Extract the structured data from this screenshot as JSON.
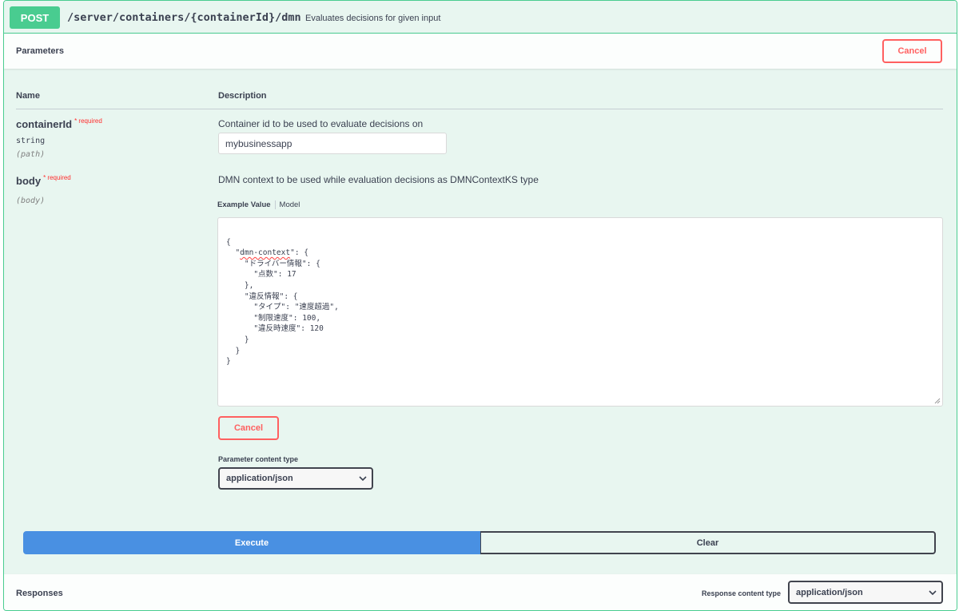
{
  "summary": {
    "method": "POST",
    "path": "/server/containers/{containerId}/dmn",
    "description": "Evaluates decisions for given input"
  },
  "parameters": {
    "title": "Parameters",
    "cancel_label": "Cancel",
    "col_name": "Name",
    "col_description": "Description",
    "required_label": "required",
    "container_id": {
      "name": "containerId",
      "type": "string",
      "in": "(path)",
      "description": "Container id to be used to evaluate decisions on",
      "value": "mybusinessapp"
    },
    "body": {
      "name": "body",
      "in": "(body)",
      "description": "DMN context to be used while evaluation decisions as DMNContextKS type",
      "tab_example": "Example Value",
      "tab_model": "Model",
      "json_lines": [
        "{",
        "  \"dmn-context\": {",
        "    \"ドライバー情報\": {",
        "      \"点数\": 17",
        "    },",
        "    \"違反情報\": {",
        "      \"タイプ\": \"速度超過\",",
        "      \"制限速度\": 100,",
        "      \"違反時速度\": 120",
        "    }",
        "  }",
        "}"
      ],
      "cancel_label": "Cancel",
      "content_type_label": "Parameter content type",
      "content_type_value": "application/json"
    }
  },
  "actions": {
    "execute_label": "Execute",
    "clear_label": "Clear"
  },
  "responses": {
    "title": "Responses",
    "content_type_label": "Response content type",
    "content_type_value": "application/json"
  },
  "colors": {
    "post_green": "#49cc90",
    "cancel_red": "#ff6060",
    "execute_blue": "#4990e2",
    "block_bg": "#e8f6f0"
  }
}
